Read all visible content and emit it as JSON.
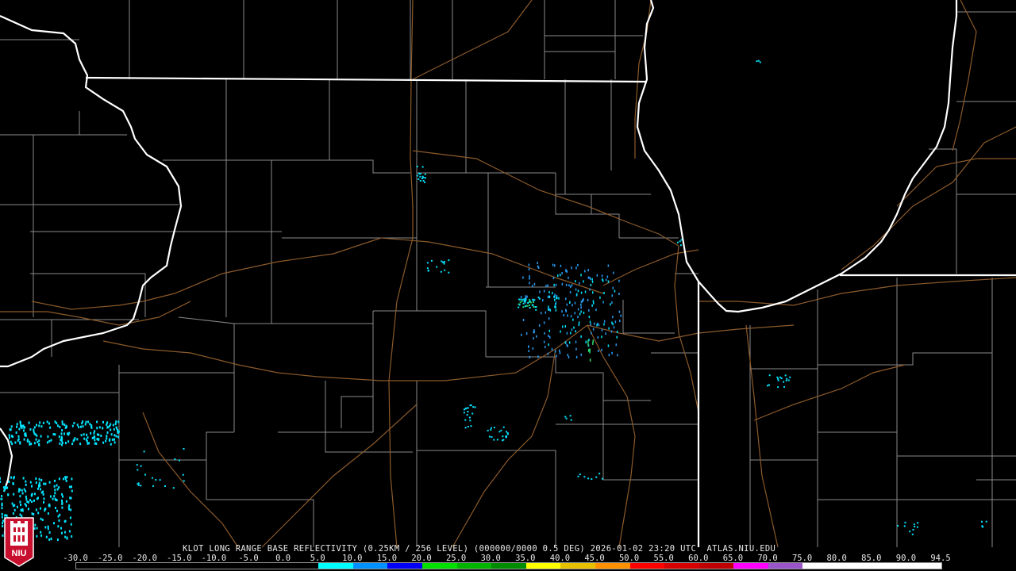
{
  "product": {
    "radar_id": "KLOT",
    "caption": "KLOT LONG RANGE BASE REFLECTIVITY (0.25KM / 256 LEVEL) (000000/0000 0.5 DEG) 2026-01-02 23:20 UTC  ATLAS.NIU.EDU"
  },
  "logo": {
    "text": "NIU",
    "background_color": "#c8102e"
  },
  "legend": {
    "labels": [
      "-30.0",
      "-25.0",
      "-20.0",
      "-15.0",
      "-10.0",
      "-5.0",
      "0.0",
      "5.0",
      "10.0",
      "15.0",
      "20.0",
      "25.0",
      "30.0",
      "35.0",
      "40.0",
      "45.0",
      "50.0",
      "55.0",
      "60.0",
      "65.0",
      "70.0",
      "75.0",
      "80.0",
      "85.0",
      "90.0",
      "94.5"
    ],
    "colors": [
      "#000000",
      "#000000",
      "#000000",
      "#000000",
      "#000000",
      "#000000",
      "#000000",
      "#00ffff",
      "#0090ff",
      "#0000f6",
      "#00e000",
      "#00b400",
      "#008c00",
      "#ffff00",
      "#e7c000",
      "#ff9000",
      "#ff0000",
      "#d60000",
      "#c00000",
      "#ff00ff",
      "#9955c9",
      "#ffffff",
      "#ffffff",
      "#ffffff",
      "#ffffff"
    ]
  },
  "map_colors": {
    "state_borders": "#ffffff",
    "county_borders": "#8a8a8a",
    "highways": "#8b5a2b",
    "echo_light": "#00e5ff",
    "echo_medium": "#2a9df4",
    "echo_strong": "#2bd36b"
  }
}
